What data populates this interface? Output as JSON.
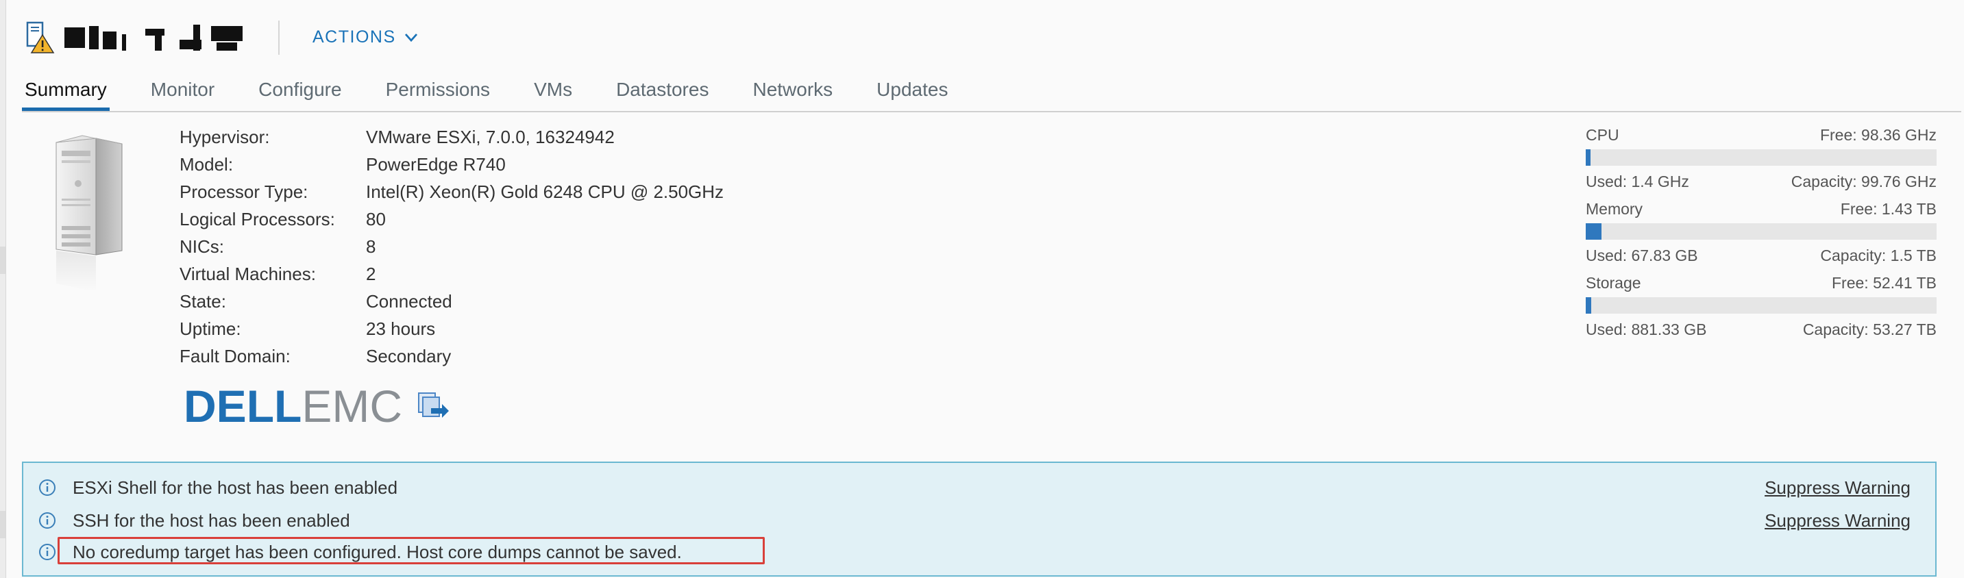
{
  "header": {
    "actions_label": "ACTIONS"
  },
  "tabs": [
    {
      "label": "Summary",
      "active": true
    },
    {
      "label": "Monitor"
    },
    {
      "label": "Configure"
    },
    {
      "label": "Permissions"
    },
    {
      "label": "VMs"
    },
    {
      "label": "Datastores"
    },
    {
      "label": "Networks"
    },
    {
      "label": "Updates"
    }
  ],
  "properties": [
    {
      "label": "Hypervisor:",
      "value": "VMware ESXi, 7.0.0, 16324942"
    },
    {
      "label": "Model:",
      "value": "PowerEdge R740"
    },
    {
      "label": "Processor Type:",
      "value": "Intel(R) Xeon(R) Gold 6248 CPU @ 2.50GHz"
    },
    {
      "label": "Logical Processors:",
      "value": "80"
    },
    {
      "label": "NICs:",
      "value": "8"
    },
    {
      "label": "Virtual Machines:",
      "value": "2"
    },
    {
      "label": "State:",
      "value": "Connected"
    },
    {
      "label": "Uptime:",
      "value": "23 hours"
    },
    {
      "label": "Fault Domain:",
      "value": "Secondary"
    }
  ],
  "vendor_logo": {
    "left": "D",
    "mid": "ELL",
    "right": "EMC"
  },
  "resources": {
    "cpu": {
      "name": "CPU",
      "free": "Free: 98.36 GHz",
      "used": "Used: 1.4 GHz",
      "capacity": "Capacity: 99.76 GHz",
      "usage_fraction": 0.014
    },
    "memory": {
      "name": "Memory",
      "free": "Free: 1.43 TB",
      "used": "Used: 67.83 GB",
      "capacity": "Capacity: 1.5 TB",
      "usage_fraction": 0.044
    },
    "storage": {
      "name": "Storage",
      "free": "Free: 52.41 TB",
      "used": "Used: 881.33 GB",
      "capacity": "Capacity: 53.27 TB",
      "usage_fraction": 0.016
    }
  },
  "warnings": [
    {
      "message": "ESXi Shell for the host has been enabled",
      "action": "Suppress Warning"
    },
    {
      "message": "SSH for the host has been enabled",
      "action": "Suppress Warning"
    },
    {
      "message": "No coredump target has been configured. Host core dumps cannot be saved.",
      "action": "",
      "highlighted": true
    }
  ],
  "colors": {
    "accent": "#1a6bad",
    "bar_fill": "#2f78be",
    "warning_bg": "#e1f1f6",
    "highlight_border": "#d9403a"
  },
  "icons": [
    "host-warning-icon",
    "chevron-down-icon",
    "server-icon",
    "launch-icon",
    "info-icon"
  ]
}
